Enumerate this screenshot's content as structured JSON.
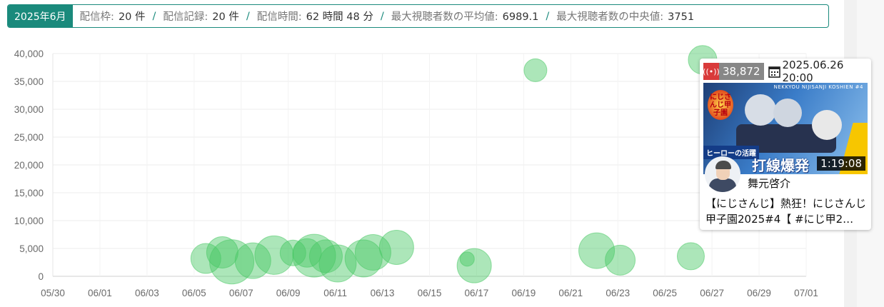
{
  "summary": {
    "month": "2025年6月",
    "stats": [
      {
        "label": "配信枠:",
        "value": "20 件"
      },
      {
        "label": "配信記録:",
        "value": "20 件"
      },
      {
        "label": "配信時間:",
        "value": "62 時間 48 分"
      },
      {
        "label": "最大視聴者数の平均値:",
        "value": "6989.1"
      },
      {
        "label": "最大視聴者数の中央値:",
        "value": "3751"
      }
    ]
  },
  "chart_data": {
    "type": "scatter",
    "xlabel": "",
    "ylabel": "",
    "xlim": [
      "05/30",
      "07/01"
    ],
    "x_ticks": [
      "05/30",
      "06/01",
      "06/03",
      "06/05",
      "06/07",
      "06/09",
      "06/11",
      "06/13",
      "06/15",
      "06/17",
      "06/19",
      "06/21",
      "06/23",
      "06/25",
      "06/27",
      "06/29",
      "07/01"
    ],
    "ylim": [
      0,
      40000
    ],
    "y_ticks": [
      "0",
      "5,000",
      "10,000",
      "15,000",
      "20,000",
      "25,000",
      "30,000",
      "35,000",
      "40,000"
    ],
    "grid": true,
    "color": "#48c864",
    "points": [
      {
        "x": 6.5,
        "y": 3200,
        "size": 21
      },
      {
        "x": 7.2,
        "y": 4300,
        "size": 22
      },
      {
        "x": 7.6,
        "y": 2600,
        "size": 31
      },
      {
        "x": 8.5,
        "y": 2800,
        "size": 25
      },
      {
        "x": 9.4,
        "y": 3800,
        "size": 27
      },
      {
        "x": 10.2,
        "y": 4200,
        "size": 18
      },
      {
        "x": 10.8,
        "y": 4200,
        "size": 20
      },
      {
        "x": 11.1,
        "y": 3700,
        "size": 30
      },
      {
        "x": 11.6,
        "y": 3600,
        "size": 23
      },
      {
        "x": 12.1,
        "y": 2300,
        "size": 26
      },
      {
        "x": 13.2,
        "y": 3200,
        "size": 26
      },
      {
        "x": 13.6,
        "y": 4300,
        "size": 25
      },
      {
        "x": 14.6,
        "y": 5200,
        "size": 24
      },
      {
        "x": 17.6,
        "y": 3100,
        "size": 10
      },
      {
        "x": 17.9,
        "y": 1900,
        "size": 24
      },
      {
        "x": 20.5,
        "y": 37000,
        "size": 16
      },
      {
        "x": 23.1,
        "y": 4600,
        "size": 25
      },
      {
        "x": 24.1,
        "y": 2900,
        "size": 21
      },
      {
        "x": 27.1,
        "y": 3600,
        "size": 19
      },
      {
        "x": 27.6,
        "y": 38872,
        "size": 20
      }
    ]
  },
  "tooltip": {
    "viewers": "38,872",
    "datetime": "2025.06.26 20:00",
    "thumb_logo_text": "にじさんじ甲子園",
    "thumb_subtitle": "NEKKYOU NIJISANJI KOSHIEN #4",
    "thumb_badge": "ヒーローの活躍",
    "thumb_big_text": "打線爆発",
    "duration": "1:19:08",
    "streamer": "舞元啓介",
    "title": "【にじさんじ】熱狂！にじさんじ甲子園2025#4【 #にじ甲2…"
  },
  "colors": {
    "accent": "#1a8a7c",
    "bubble": "#48c864",
    "live": "#d93a3a"
  }
}
